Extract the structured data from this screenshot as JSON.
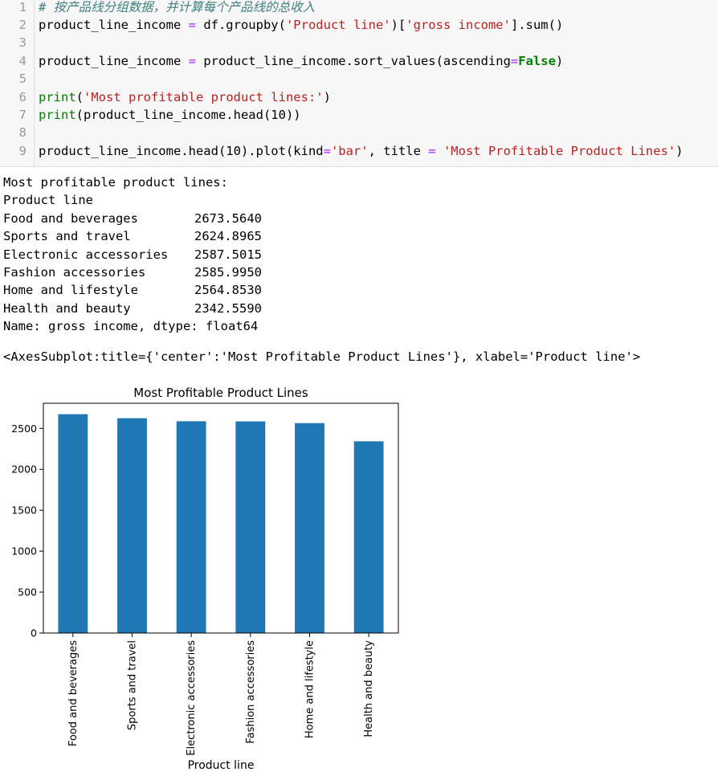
{
  "code": {
    "lines": [
      {
        "no": "1",
        "tokens": [
          {
            "t": "# 按产品线分组数据，并计算每个产品线的总收入",
            "c": "t-comment"
          }
        ]
      },
      {
        "no": "2",
        "tokens": [
          {
            "t": "product_line_income ",
            "c": ""
          },
          {
            "t": "=",
            "c": "t-op"
          },
          {
            "t": " df.groupby(",
            "c": ""
          },
          {
            "t": "'Product line'",
            "c": "t-str"
          },
          {
            "t": ")[",
            "c": ""
          },
          {
            "t": "'gross income'",
            "c": "t-str"
          },
          {
            "t": "].sum()",
            "c": ""
          }
        ]
      },
      {
        "no": "3",
        "tokens": []
      },
      {
        "no": "4",
        "tokens": [
          {
            "t": "product_line_income ",
            "c": ""
          },
          {
            "t": "=",
            "c": "t-op"
          },
          {
            "t": " product_line_income.sort_values(ascending",
            "c": ""
          },
          {
            "t": "=",
            "c": "t-op"
          },
          {
            "t": "False",
            "c": "t-kwb"
          },
          {
            "t": ")",
            "c": ""
          }
        ]
      },
      {
        "no": "5",
        "tokens": []
      },
      {
        "no": "6",
        "tokens": [
          {
            "t": "print",
            "c": "t-kw"
          },
          {
            "t": "(",
            "c": ""
          },
          {
            "t": "'Most profitable product lines:'",
            "c": "t-str"
          },
          {
            "t": ")",
            "c": ""
          }
        ]
      },
      {
        "no": "7",
        "tokens": [
          {
            "t": "print",
            "c": "t-kw"
          },
          {
            "t": "(product_line_income.head(10))",
            "c": ""
          }
        ]
      },
      {
        "no": "8",
        "tokens": []
      },
      {
        "no": "9",
        "tokens": [
          {
            "t": "product_line_income.head(10).plot(kind",
            "c": ""
          },
          {
            "t": "=",
            "c": "t-op"
          },
          {
            "t": "'bar'",
            "c": "t-str"
          },
          {
            "t": ", title ",
            "c": ""
          },
          {
            "t": "=",
            "c": "t-op"
          },
          {
            "t": " ",
            "c": ""
          },
          {
            "t": "'Most Profitable Product Lines'",
            "c": "t-str"
          },
          {
            "t": ")",
            "c": ""
          }
        ]
      }
    ]
  },
  "output": {
    "header": "Most profitable product lines:",
    "index_name": "Product line",
    "rows": [
      {
        "label": "Food and beverages",
        "value": "2673.5640"
      },
      {
        "label": "Sports and travel",
        "value": "2624.8965"
      },
      {
        "label": "Electronic accessories",
        "value": "2587.5015"
      },
      {
        "label": "Fashion accessories",
        "value": "2585.9950"
      },
      {
        "label": "Home and lifestyle",
        "value": "2564.8530"
      },
      {
        "label": "Health and beauty",
        "value": "2342.5590"
      }
    ],
    "footer": "Name: gross income, dtype: float64",
    "repr": "<AxesSubplot:title={'center':'Most Profitable Product Lines'}, xlabel='Product line'>"
  },
  "chart_data": {
    "type": "bar",
    "title": "Most Profitable Product Lines",
    "xlabel": "Product line",
    "ylabel": "",
    "categories": [
      "Food and beverages",
      "Sports and travel",
      "Electronic accessories",
      "Fashion accessories",
      "Home and lifestyle",
      "Health and beauty"
    ],
    "values": [
      2673.564,
      2624.8965,
      2587.5015,
      2585.995,
      2564.853,
      2342.559
    ],
    "ylim": [
      0,
      2807.24
    ],
    "yticks": [
      0,
      500,
      1000,
      1500,
      2000,
      2500
    ],
    "grid": false,
    "legend": "none",
    "bar_color": "#1f77b4"
  },
  "colors": {
    "comment": "#408080",
    "string": "#ba2121",
    "keyword": "#008000",
    "operator": "#aa22ff"
  }
}
